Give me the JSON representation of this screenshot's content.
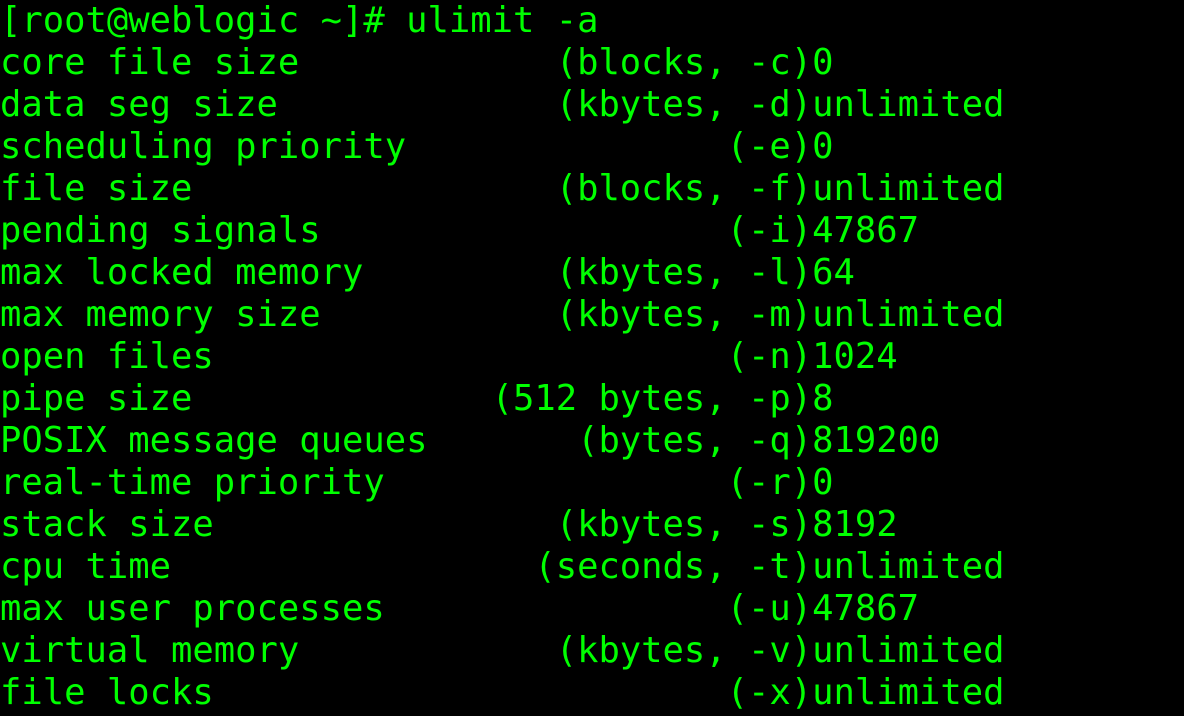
{
  "prompt": "[root@weblogic ~]# ulimit -a",
  "rows": [
    {
      "name": "core file size",
      "unit": "(blocks, -c)",
      "value": "0"
    },
    {
      "name": "data seg size",
      "unit": "(kbytes, -d)",
      "value": "unlimited"
    },
    {
      "name": "scheduling priority",
      "unit": "(-e)",
      "value": "0"
    },
    {
      "name": "file size",
      "unit": "(blocks, -f)",
      "value": "unlimited"
    },
    {
      "name": "pending signals",
      "unit": "(-i)",
      "value": "47867"
    },
    {
      "name": "max locked memory",
      "unit": "(kbytes, -l)",
      "value": "64"
    },
    {
      "name": "max memory size",
      "unit": "(kbytes, -m)",
      "value": "unlimited"
    },
    {
      "name": "open files",
      "unit": "(-n)",
      "value": "1024"
    },
    {
      "name": "pipe size",
      "unit": "(512 bytes, -p)",
      "value": "8"
    },
    {
      "name": "POSIX message queues",
      "unit": "(bytes, -q)",
      "value": "819200"
    },
    {
      "name": "real-time priority",
      "unit": "(-r)",
      "value": "0"
    },
    {
      "name": "stack size",
      "unit": "(kbytes, -s)",
      "value": "8192"
    },
    {
      "name": "cpu time",
      "unit": "(seconds, -t)",
      "value": "unlimited"
    },
    {
      "name": "max user processes",
      "unit": "(-u)",
      "value": "47867"
    },
    {
      "name": "virtual memory",
      "unit": "(kbytes, -v)",
      "value": "unlimited"
    },
    {
      "name": "file locks",
      "unit": "(-x)",
      "value": "unlimited"
    }
  ],
  "layout": {
    "unit_right_edge": 38,
    "value_col": 39
  },
  "watermark": ""
}
